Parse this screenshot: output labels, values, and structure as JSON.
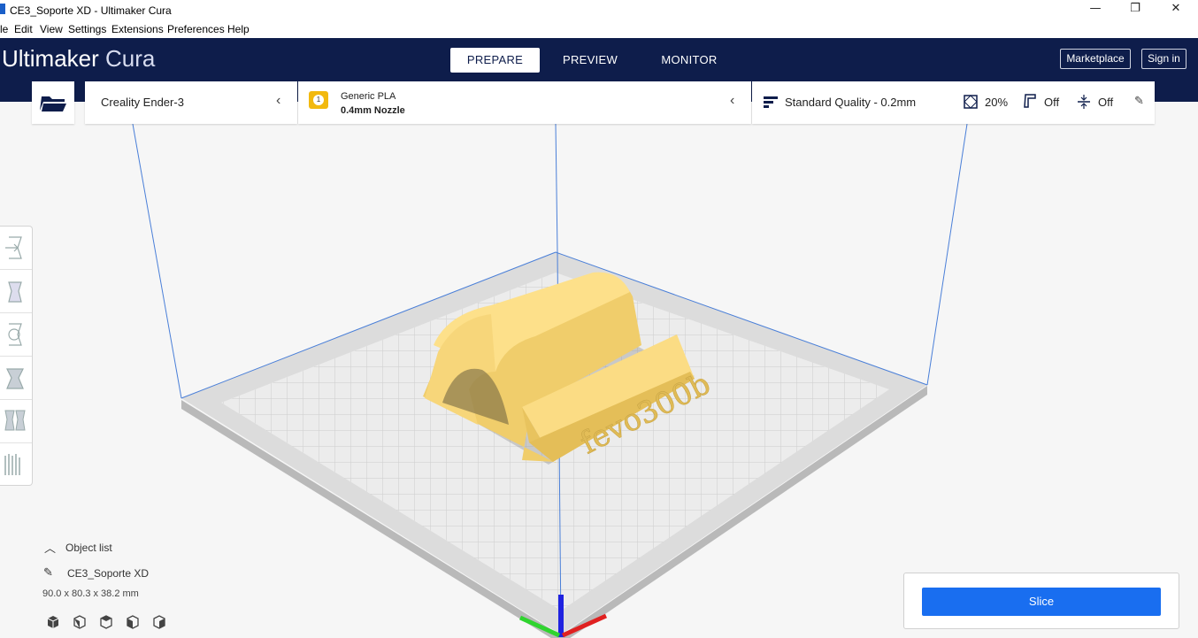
{
  "window": {
    "title": "CE3_Soporte XD - Ultimaker Cura",
    "controls": {
      "minimize": "—",
      "maximize": "❐",
      "close": "✕"
    }
  },
  "menu": [
    "le",
    "Edit",
    "View",
    "Settings",
    "Extensions",
    "Preferences",
    "Help"
  ],
  "header": {
    "logo_brand": "Ultimaker",
    "logo_product": "Cura",
    "tabs": [
      "PREPARE",
      "PREVIEW",
      "MONITOR"
    ],
    "active_tab": "PREPARE",
    "marketplace_label": "Marketplace",
    "signin_label": "Sign in"
  },
  "printer": {
    "name": "Creality Ender-3"
  },
  "material": {
    "badge": "1",
    "name": "Generic PLA",
    "nozzle": "0.4mm Nozzle"
  },
  "settings": {
    "quality": "Standard Quality - 0.2mm",
    "infill": "20%",
    "support": "Off",
    "adhesion": "Off"
  },
  "model": {
    "embossed_text": "fevo300b"
  },
  "object_list": {
    "label": "Object list",
    "object_name": "CE3_Soporte XD",
    "dimensions": "90.0 x 80.3 x 38.2 mm"
  },
  "slice": {
    "label": "Slice"
  },
  "colors": {
    "header_bg": "#0e1d4b",
    "accent": "#196ef0",
    "model": "#fbd97a"
  }
}
